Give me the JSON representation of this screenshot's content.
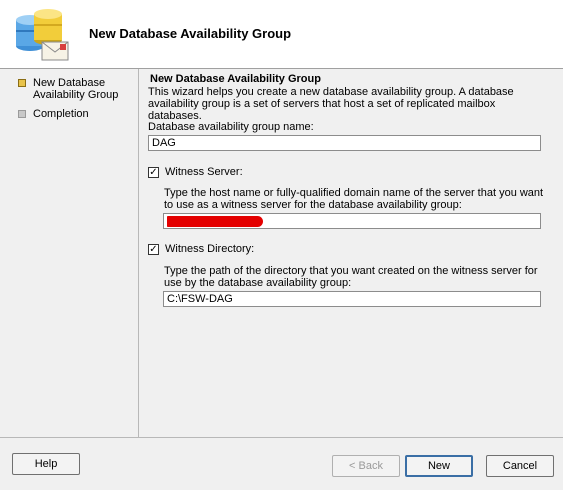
{
  "header": {
    "title": "New Database Availability Group",
    "icon": "database-mail-icon"
  },
  "steps": [
    {
      "label": "New Database Availability Group",
      "active": true
    },
    {
      "label": "Completion",
      "active": false
    }
  ],
  "content": {
    "section_title": "New Database Availability Group",
    "description": "This wizard helps you create a new database availability group. A database availability group is a set of servers that host a set of replicated mailbox databases.",
    "name_label": "Database availability group name:",
    "name_value": "DAG",
    "witness_server": {
      "label": "Witness Server:",
      "checked": true,
      "hint": "Type the host name or fully-qualified domain name of the server that you want to use as a witness server for the database availability group:",
      "value": ""
    },
    "witness_directory": {
      "label": "Witness Directory:",
      "checked": true,
      "hint": "Type the path of the directory that you want created on the witness server for use by the database availability group:",
      "value": "C:\\FSW-DAG"
    }
  },
  "buttons": {
    "help": "Help",
    "back": "< Back",
    "next": "New",
    "cancel": "Cancel"
  },
  "colors": {
    "active_step": "#e8c34a",
    "redaction": "#e40000",
    "default_button_border": "#3a6ea5"
  }
}
